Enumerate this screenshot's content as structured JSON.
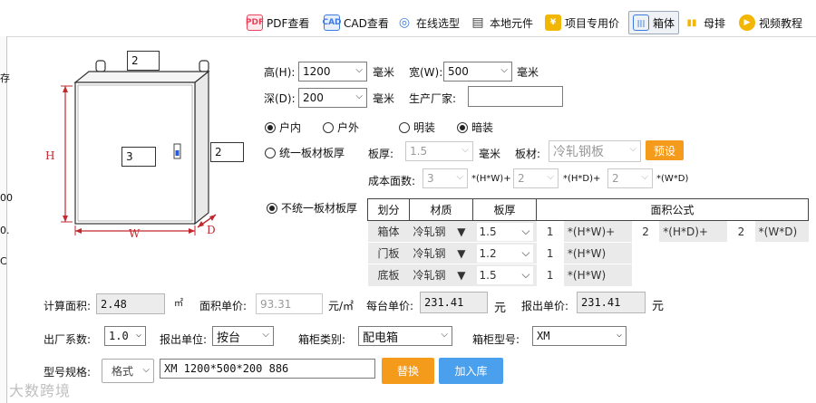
{
  "toolbar": {
    "items": [
      {
        "label": "PDF查看",
        "icon": "pdf-icon",
        "color": "#e8425b"
      },
      {
        "label": "CAD查看",
        "icon": "cad-icon",
        "color": "#3d7be0"
      },
      {
        "label": "在线选型",
        "icon": "magnifier-icon",
        "color": "#3d7be0"
      },
      {
        "label": "本地元件",
        "icon": "component-icon",
        "color": "#555555"
      },
      {
        "label": "项目专用价",
        "icon": "yen-icon",
        "color": "#f2b705"
      },
      {
        "label": "箱体",
        "icon": "cabinet-icon",
        "color": "#3d7be0"
      },
      {
        "label": "母排",
        "icon": "busbar-icon",
        "color": "#f2b705"
      },
      {
        "label": "视频教程",
        "icon": "video-icon",
        "color": "#f2b705"
      }
    ],
    "icon_glyphs": [
      "PDF",
      "CAD",
      "◎",
      "▤",
      "¥",
      "|||",
      "▮▮",
      "▶"
    ]
  },
  "diagram": {
    "top_box": "2",
    "center_box": "3",
    "right_box": "2",
    "label_h": "H",
    "label_w": "W",
    "label_d": "D",
    "accent": "#c1272d"
  },
  "dims": {
    "height_label": "高(H):",
    "height_value": "1200",
    "width_label": "宽(W):",
    "width_value": "500",
    "depth_label": "深(D):",
    "depth_value": "200",
    "unit_mm": "毫米",
    "maker_label": "生产厂家:",
    "maker_value": ""
  },
  "options": {
    "indoor": "户内",
    "outdoor": "户外",
    "surface": "明装",
    "flush": "暗装"
  },
  "unified": {
    "radio_label": "统一板材板厚",
    "thickness_label": "板厚:",
    "thickness_value": "1.5",
    "unit_mm": "毫米",
    "material_label": "板材:",
    "material_value": "冷轧钢板",
    "preset_button": "预设",
    "cost_label": "成本面数:",
    "f1": "3",
    "t1": "*(H*W)+",
    "f2": "2",
    "t2": "*(H*D)+",
    "f3": "2",
    "t3": "*(W*D)"
  },
  "nonunified": {
    "radio_label": "不统一板材板厚",
    "headers": [
      "划分",
      "材质",
      "板厚",
      "面积公式"
    ],
    "rows": [
      {
        "part": "箱体",
        "material": "冷轧钢",
        "thickness": "1.5",
        "c1": "1",
        "e1": "*(H*W)+",
        "c2": "2",
        "e2": "*(H*D)+",
        "c3": "2",
        "e3": "*(W*D)"
      },
      {
        "part": "门板",
        "material": "冷轧钢",
        "thickness": "1.2",
        "c1": "1",
        "e1": "*(H*W)"
      },
      {
        "part": "底板",
        "material": "冷轧钢",
        "thickness": "1.5",
        "c1": "1",
        "e1": "*(H*W)"
      }
    ]
  },
  "calc": {
    "area_label": "计算面积:",
    "area_value": "2.48",
    "area_unit": "㎡",
    "unit_price_label": "面积单价:",
    "unit_price_value": "93.31",
    "unit_price_unit": "元/㎡",
    "each_label": "每台单价:",
    "each_value": "231.41",
    "yuan": "元",
    "quote_label": "报出单价:",
    "quote_value": "231.41",
    "yuan2": "元"
  },
  "bottom": {
    "factor_label": "出厂系数:",
    "factor_value": "1.0",
    "unit_label": "报出单位:",
    "unit_value": "按台",
    "type_label": "箱柜类别:",
    "type_value": "配电箱",
    "model_label": "箱柜型号:",
    "model_value": "XM",
    "spec_label": "型号规格:",
    "format_value": "格式",
    "spec_value": "XM 1200*500*200 886",
    "replace_button": "替换",
    "add_button": "加入库"
  },
  "left_edge": [
    "存",
    "",
    "",
    "",
    "00",
    "0.",
    "C"
  ],
  "watermark": "大数跨境"
}
